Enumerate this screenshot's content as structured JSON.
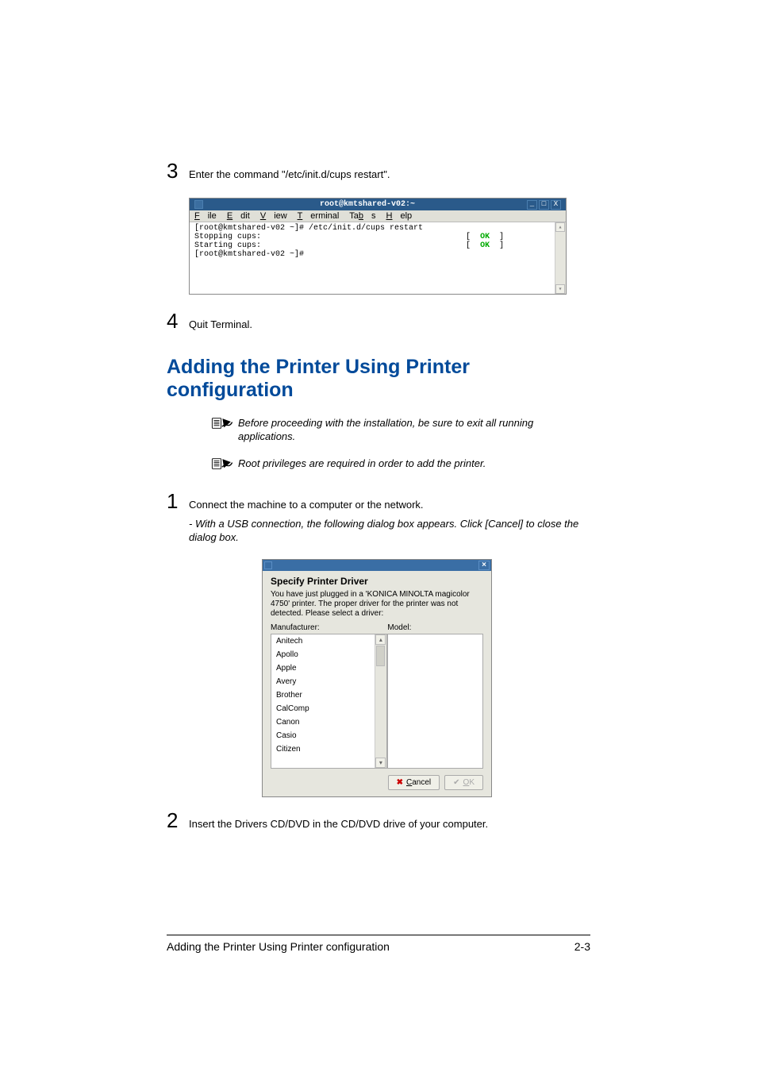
{
  "steps": {
    "s3": {
      "num": "3",
      "text": "Enter the command \"/etc/init.d/cups restart\"."
    },
    "s4": {
      "num": "4",
      "text": "Quit Terminal."
    },
    "s1": {
      "num": "1",
      "text": "Connect the machine to a computer or the network."
    },
    "s1_sub": "- With a USB connection, the following dialog box appears. Click [Cancel] to close the dialog box.",
    "s2": {
      "num": "2",
      "text": "Insert the Drivers CD/DVD in the CD/DVD drive of your computer."
    }
  },
  "terminal": {
    "title": "root@kmtshared-v02:~",
    "menu": {
      "file": "File",
      "edit": "Edit",
      "view": "View",
      "terminal": "Terminal",
      "tabs": "Tabs",
      "help": "Help"
    },
    "line1": "[root@kmtshared-v02 ~]# /etc/init.d/cups restart",
    "line2_l": "Stopping cups:",
    "line2_r": "[  OK  ]",
    "line3_l": "Starting cups:",
    "line3_r": "[  OK  ]",
    "line4": "[root@kmtshared-v02 ~]#",
    "controls": {
      "min": "_",
      "max": "□",
      "close": "X"
    }
  },
  "heading": "Adding the Printer Using Printer configuration",
  "notes": {
    "n1": "Before proceeding with the installation, be sure to exit all running applications.",
    "n2": "Root privileges are required in order to add the printer."
  },
  "dialog": {
    "close": "×",
    "title": "Specify Printer Driver",
    "desc": "You have just plugged in a 'KONICA MINOLTA magicolor 4750' printer. The proper driver for the printer was not detected. Please select a driver:",
    "manufacturer_label": "Manufacturer:",
    "model_label": "Model:",
    "manufacturers": [
      "Anitech",
      "Apollo",
      "Apple",
      "Avery",
      "Brother",
      "CalComp",
      "Canon",
      "Casio",
      "Citizen"
    ],
    "cancel": "Cancel",
    "ok": "OK"
  },
  "footer": {
    "left": "Adding the Printer Using Printer configuration",
    "right": "2-3"
  }
}
